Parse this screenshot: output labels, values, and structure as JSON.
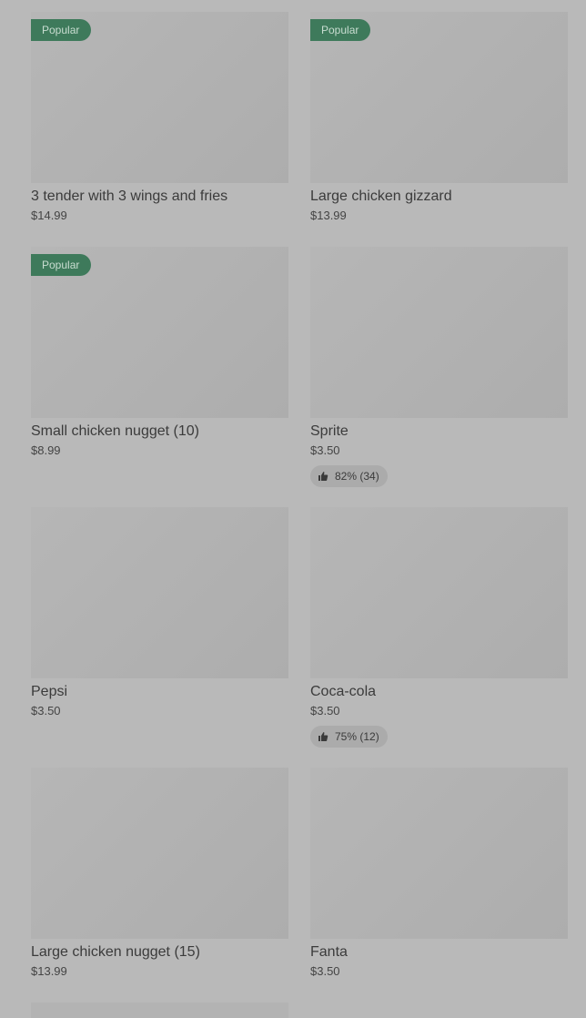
{
  "colors": {
    "background": "#b9b9b9",
    "image_placeholder": "#b1b1b1",
    "popular_badge": "#3e7a5b",
    "rating_pill": "#ababab"
  },
  "items": [
    {
      "name": "3 tender with 3 wings and fries",
      "price": "$14.99",
      "badge": "Popular"
    },
    {
      "name": "Large chicken gizzard",
      "price": "$13.99",
      "badge": "Popular"
    },
    {
      "name": "Small chicken nugget (10)",
      "price": "$8.99",
      "badge": "Popular"
    },
    {
      "name": "Sprite",
      "price": "$3.50",
      "rating": "82% (34)",
      "rating_icon": "thumbs-up-icon"
    },
    {
      "name": "Pepsi",
      "price": "$3.50"
    },
    {
      "name": "Coca-cola",
      "price": "$3.50",
      "rating": "75% (12)",
      "rating_icon": "thumbs-up-icon"
    },
    {
      "name": "Large chicken nugget (15)",
      "price": "$13.99"
    },
    {
      "name": "Fanta",
      "price": "$3.50"
    }
  ]
}
